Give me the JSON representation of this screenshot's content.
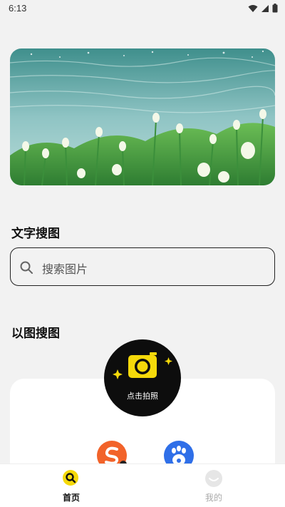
{
  "status_bar": {
    "time": "6:13"
  },
  "text_search": {
    "title": "文字搜图",
    "placeholder": "搜索图片"
  },
  "image_search": {
    "title": "以图搜图",
    "camera_label": "点击拍照"
  },
  "apps": [
    {
      "name": "sogou-app-icon"
    },
    {
      "name": "baidu-app-icon"
    }
  ],
  "bottom_nav": {
    "items": [
      {
        "label": "首页",
        "active": true
      },
      {
        "label": "我的",
        "active": false
      }
    ]
  },
  "colors": {
    "accent": "#f5d90a",
    "background": "#f2f2f2"
  }
}
